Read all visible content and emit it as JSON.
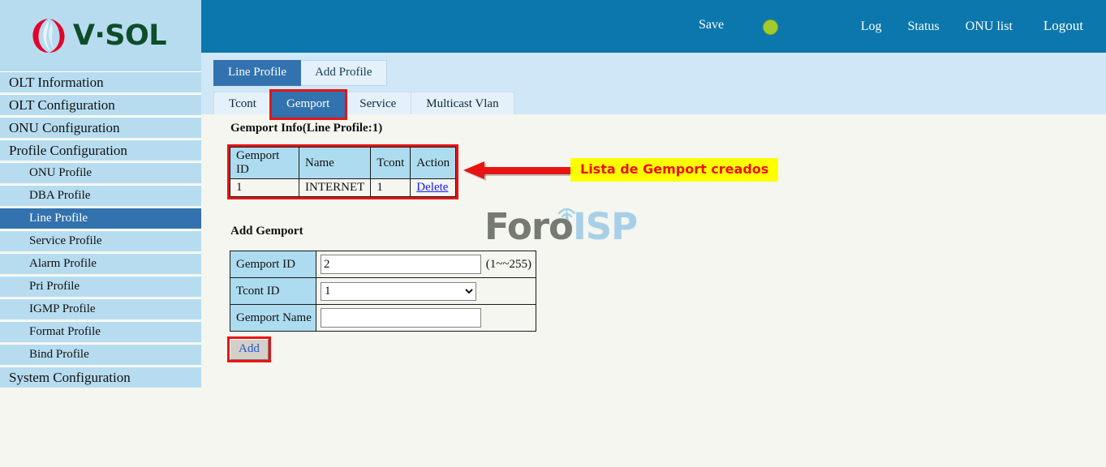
{
  "brand": {
    "name": "V·SOL",
    "logo_icon": "vsol-flame-logo"
  },
  "header": {
    "save_label": "Save",
    "status_dot": "status-indicator-green",
    "status_dot_color": "#a4cb2e",
    "background_color": "#0b77ac",
    "links": [
      {
        "label": "Log"
      },
      {
        "label": "Status"
      },
      {
        "label": "ONU list"
      },
      {
        "label": "Logout"
      }
    ]
  },
  "sidebar": {
    "items": [
      {
        "label": "OLT Information",
        "level": 0,
        "active": false
      },
      {
        "label": "OLT Configuration",
        "level": 0,
        "active": false
      },
      {
        "label": "ONU Configuration",
        "level": 0,
        "active": false
      },
      {
        "label": "Profile Configuration",
        "level": 0,
        "active": false
      },
      {
        "label": "ONU Profile",
        "level": 1,
        "active": false
      },
      {
        "label": "DBA Profile",
        "level": 1,
        "active": false
      },
      {
        "label": "Line Profile",
        "level": 1,
        "active": true
      },
      {
        "label": "Service Profile",
        "level": 1,
        "active": false
      },
      {
        "label": "Alarm Profile",
        "level": 1,
        "active": false
      },
      {
        "label": "Pri Profile",
        "level": 1,
        "active": false
      },
      {
        "label": "IGMP Profile",
        "level": 1,
        "active": false
      },
      {
        "label": "Format Profile",
        "level": 1,
        "active": false
      },
      {
        "label": "Bind Profile",
        "level": 1,
        "active": false
      },
      {
        "label": "System Configuration",
        "level": 0,
        "active": false
      }
    ],
    "active_color": "#3272ae",
    "item_color": "#b7dcf0"
  },
  "tabs_primary": [
    {
      "label": "Line Profile",
      "active": true
    },
    {
      "label": "Add Profile",
      "active": false
    }
  ],
  "tabs_secondary": [
    {
      "label": "Tcont",
      "active": false,
      "marked": false
    },
    {
      "label": "Gemport",
      "active": true,
      "marked": true
    },
    {
      "label": "Service",
      "active": false,
      "marked": false
    },
    {
      "label": "Multicast Vlan",
      "active": false,
      "marked": false
    }
  ],
  "main": {
    "info_title": "Gemport Info(Line Profile:1)",
    "info_table": {
      "columns": [
        "Gemport ID",
        "Name",
        "Tcont",
        "Action"
      ],
      "rows": [
        {
          "gemport_id": "1",
          "name": "INTERNET",
          "tcont": "1",
          "action": "Delete"
        }
      ]
    },
    "callout": {
      "text": "Lista de Gemport creados",
      "bg_color": "#ffff00",
      "text_color": "#ee1111",
      "arrow_color": "#e81414"
    },
    "add_title": "Add Gemport",
    "form": {
      "gemport_id_label": "Gemport ID",
      "gemport_id_value": "2",
      "gemport_id_hint": "(1~~255)",
      "tcont_id_label": "Tcont ID",
      "tcont_id_value": "1",
      "tcont_id_options": [
        "1"
      ],
      "gemport_name_label": "Gemport Name",
      "gemport_name_value": "",
      "add_button_label": "Add"
    },
    "watermark": {
      "part1": "Foro",
      "part2": "ISP",
      "icon": "wifi-antenna-icon"
    }
  }
}
